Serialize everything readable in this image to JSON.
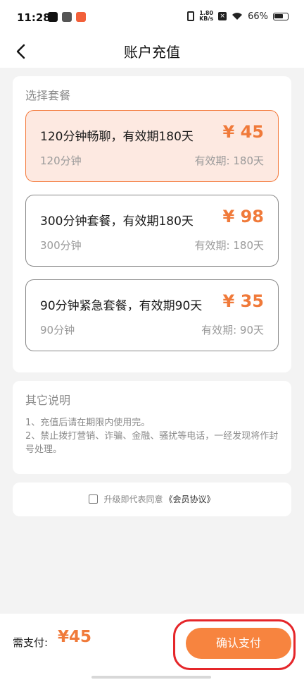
{
  "status_bar": {
    "time": "11:28",
    "network_speed_top": "1.80",
    "network_speed_bottom": "KB/s",
    "battery": "66%"
  },
  "header": {
    "title": "账户充值",
    "back_icon": "chevron-left-icon"
  },
  "plans_section": {
    "label": "选择套餐",
    "selected_index": 0,
    "plans": [
      {
        "title": "120分钟畅聊，有效期180天",
        "price": "¥ 45",
        "minutes": "120分钟",
        "validity": "有效期: 180天"
      },
      {
        "title": "300分钟套餐，有效期180天",
        "price": "¥ 98",
        "minutes": "300分钟",
        "validity": "有效期: 180天"
      },
      {
        "title": "90分钟紧急套餐，有效期90天",
        "price": "¥ 35",
        "minutes": "90分钟",
        "validity": "有效期: 90天"
      }
    ]
  },
  "notes": {
    "title": "其它说明",
    "lines": [
      "1、充值后请在期限内使用完。",
      "2、禁止拨打营销、诈骗、金融、骚扰等电话，一经发现将作封号处理。"
    ]
  },
  "agreement": {
    "checked": false,
    "text": "升级即代表同意",
    "link": "《会员协议》"
  },
  "footer": {
    "pay_label": "需支付:",
    "pay_amount": "¥45",
    "confirm_label": "确认支付"
  },
  "colors": {
    "accent": "#f7843f",
    "price": "#f07a3a",
    "selected_bg": "#fde9e1",
    "highlight": "#e5262a"
  }
}
